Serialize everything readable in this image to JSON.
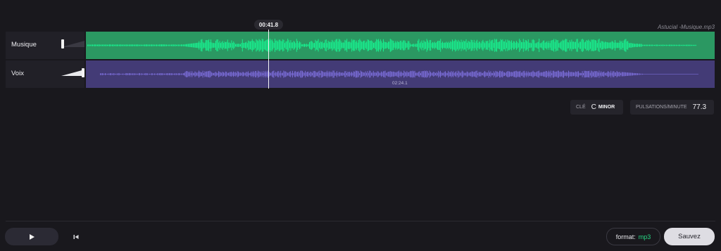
{
  "playhead_time": "00:41.8",
  "file_name": "Astucial -Musique.mp3",
  "tracks": [
    {
      "name": "Musique",
      "volume": 0.0,
      "color": "#2b9862",
      "wave_color": "#18f08f"
    },
    {
      "name": "Voix",
      "volume": 1.0,
      "color": "#433b76",
      "wave_color": "#7a6cd6"
    }
  ],
  "duration": "02:24.1",
  "key_label": "CLÉ",
  "key_value": "C",
  "key_mode": "MINOR",
  "bpm_label": "PULSATIONS/MINUTE",
  "bpm_value": "77.3",
  "format_label": "format:",
  "format_value": "mp3",
  "save_label": "Sauvez",
  "icons": {
    "play": "play-icon",
    "rewind": "skip-back-icon"
  }
}
